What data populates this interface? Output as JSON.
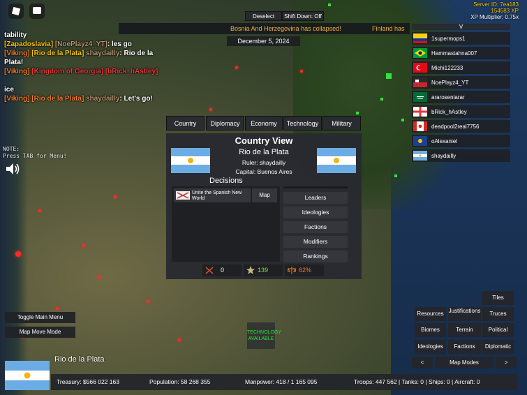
{
  "server": {
    "id_label": "Server ID: 7ea183",
    "xp_label": "154583 XP",
    "multiplier_label": "XP Multiplier: 0.75x"
  },
  "top_controls": {
    "deselect": "Deselect",
    "shift_down": "Shift Down: Off"
  },
  "news": {
    "main": "Bosnia And Herzegovina has collapsed!",
    "secondary": "Finland has"
  },
  "date": "December 5, 2024",
  "chat": [
    {
      "parts": [
        {
          "t": "tability",
          "c": "c-white"
        }
      ]
    },
    {
      "parts": [
        {
          "t": "[Zapadoslavia] ",
          "c": "c-yellow"
        },
        {
          "t": "[NoePlayz4_YT]",
          "c": "c-dim"
        },
        {
          "t": ": les go",
          "c": "c-white"
        }
      ]
    },
    {
      "parts": [
        {
          "t": "[Viking] ",
          "c": "c-orange"
        },
        {
          "t": "[Rio de la Plata] ",
          "c": "c-yellow"
        },
        {
          "t": "shaydailly",
          "c": "c-dim"
        },
        {
          "t": ":  Rio de la Plata!",
          "c": "c-white"
        }
      ]
    },
    {
      "parts": [
        {
          "t": "[Viking] ",
          "c": "c-orange"
        },
        {
          "t": "[Kingdom of Georgia] ",
          "c": "c-red"
        },
        {
          "t": "[bRick_hAstley]",
          "c": "c-red"
        }
      ]
    },
    {
      "parts": []
    },
    {
      "parts": [
        {
          "t": "ice",
          "c": "c-white"
        }
      ]
    },
    {
      "parts": [
        {
          "t": "[Viking] ",
          "c": "c-orange"
        },
        {
          "t": "[Rio de la Plata] ",
          "c": "c-orange"
        },
        {
          "t": "shaydailly",
          "c": "c-dim"
        },
        {
          "t": ":  Let's go!",
          "c": "c-white"
        }
      ]
    }
  ],
  "note": {
    "line1": "NOTE:",
    "line2": "Press TAB for Menu!"
  },
  "player_list": {
    "header": "V",
    "players": [
      {
        "name": "1supermops1",
        "flag": "flag-colombia"
      },
      {
        "name": "Hammastahna007",
        "flag": "flag-brazil"
      },
      {
        "name": "Michi122233",
        "flag": "flag-turkey"
      },
      {
        "name": "NoePlayz4_YT",
        "flag": "flag-zapadoslavia"
      },
      {
        "name": "araroseniarar",
        "flag": "flag-saudi"
      },
      {
        "name": "bRick_hAstley",
        "flag": "flag-georgia"
      },
      {
        "name": "deadpool2real7756",
        "flag": "flag-canada"
      },
      {
        "name": "oAlexaniel",
        "flag": "flag-unknown"
      },
      {
        "name": "shaydailly",
        "flag": "flag-rio-de-la-plata"
      }
    ]
  },
  "country_view": {
    "tabs": [
      "Country",
      "Diplomacy",
      "Economy",
      "Technology",
      "Military"
    ],
    "title": "Country View",
    "name": "Rio de la Plata",
    "ruler": "Ruler: shaydailly",
    "capital": "Capital: Buenos Aires",
    "decisions_title": "Decisions",
    "decision": {
      "label": "Unite the Spanish New World",
      "map_button": "Map",
      "icon": "decision-flag-icon"
    },
    "side_buttons": [
      "Leaders",
      "Ideologies",
      "Factions",
      "Modifiers",
      "Rankings"
    ],
    "stats": {
      "war": "0",
      "stars": "139",
      "stability": "62%"
    }
  },
  "left_buttons": {
    "toggle_main_menu": "Toggle Main Menu",
    "map_move_mode": "Map Move Mode"
  },
  "tech_available": "TECHNOLOGY AVAILABLE",
  "right_buttons": {
    "tiles": "Tiles",
    "resources": "Resources",
    "justifications": "Justifications",
    "truces": "Truces",
    "biomes": "Biomes",
    "terrain": "Terrain",
    "political": "Political",
    "ideologies": "Ideologies",
    "factions": "Factions",
    "diplomatic": "Diplomatic",
    "prev": "<",
    "map_modes": "Map Modes",
    "next": ">"
  },
  "bottom": {
    "country_name": "Rio de la Plata",
    "treasury": "Treasury:  $566 022 163",
    "population": "Population: 58 268 355",
    "manpower": "Manpower:  418  /  1 165 095",
    "troops": "Troops: 447 562  |  Tanks: 0  |  Ships: 0  |  Aircraft: 0"
  },
  "colors": {
    "accent_yellow": "#f4c20d",
    "news_orange": "#f4b23a",
    "tech_green": "#2ee03b",
    "stars_green": "#8ad94a",
    "stability_orange": "#f07b2b"
  }
}
